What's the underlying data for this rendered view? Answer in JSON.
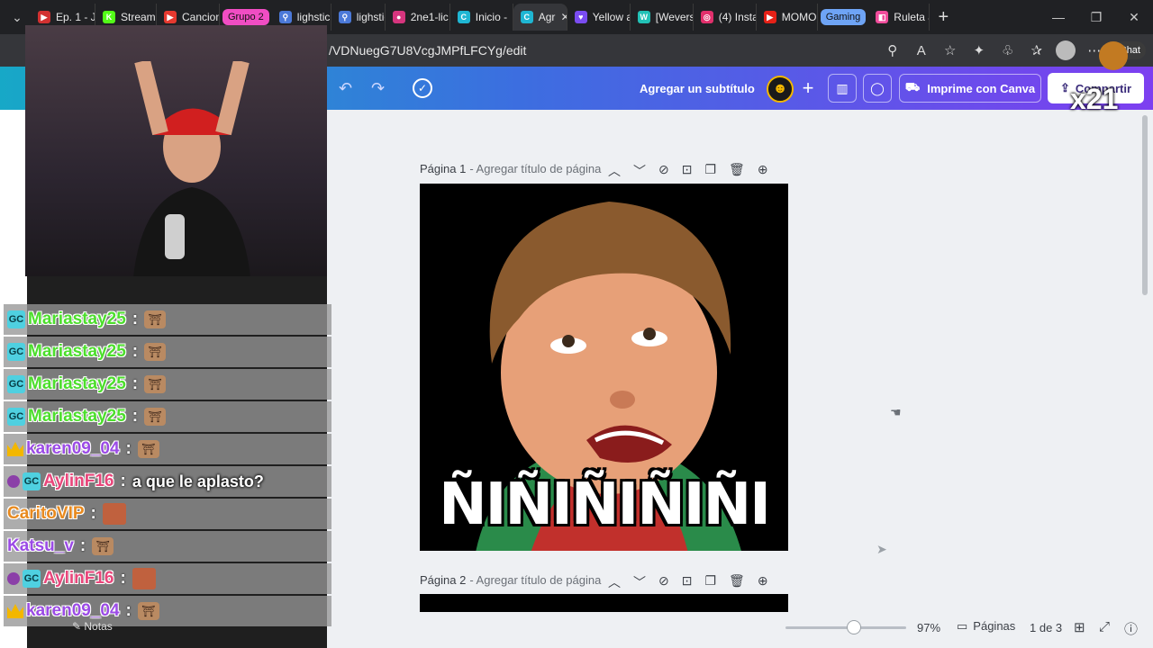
{
  "browser": {
    "tabs": [
      {
        "label": "Ep. 1 - J",
        "fav_color": "#d23131",
        "fav_glyph": "▶"
      },
      {
        "label": "Stream",
        "fav_color": "#53fc18",
        "fav_glyph": "K"
      },
      {
        "label": "Cancion",
        "fav_color": "#e6392f",
        "fav_glyph": "▶"
      },
      {
        "label": "lighstick",
        "fav_color": "#4b79d8",
        "fav_glyph": "⚲"
      },
      {
        "label": "lighstick",
        "fav_color": "#4b79d8",
        "fav_glyph": "⚲"
      },
      {
        "label": "2ne1-lic",
        "fav_color": "#d6357e",
        "fav_glyph": "●"
      },
      {
        "label": "Inicio -",
        "fav_color": "#1fb6d3",
        "fav_glyph": "C"
      },
      {
        "label": "Agr",
        "fav_color": "#1fb6d3",
        "fav_glyph": "C",
        "active": true
      },
      {
        "label": "Yellow a",
        "fav_color": "#7a4cf0",
        "fav_glyph": "♥"
      },
      {
        "label": "[Wevers",
        "fav_color": "#22c1b6",
        "fav_glyph": "W"
      },
      {
        "label": "(4) Insta",
        "fav_color": "#e1306c",
        "fav_glyph": "◎"
      },
      {
        "label": "MOMO",
        "fav_color": "#e62117",
        "fav_glyph": "▶"
      },
      {
        "label": "Ruleta a",
        "fav_color": "#f04c9b",
        "fav_glyph": "◧"
      }
    ],
    "groups": {
      "grupo2": "Grupo 2",
      "gaming": "Gaming"
    },
    "url": "/VDNuegG7U8VcgJMPfLFCYg/edit",
    "chat_label": "Chat"
  },
  "canva": {
    "subtitle": "Agregar un subtítulo",
    "print_label": "Imprime con Canva",
    "share_label": "Compartir",
    "page1_label": "Página 1",
    "page1_title": "- Agregar título de página",
    "page2_label": "Página 2",
    "page2_title": "- Agregar título de página",
    "meme_text": "ÑIÑIÑIÑIÑI",
    "zoom": "97%",
    "pages_label": "Páginas",
    "page_count": "1 de 3",
    "notes_label": "Notas"
  },
  "overlay": {
    "multiplier": "x21"
  },
  "chat": [
    {
      "name": "Mariastay25",
      "color": "#4cde2c",
      "badges": [
        "gc"
      ],
      "message": "",
      "emote": "shrine"
    },
    {
      "name": "Mariastay25",
      "color": "#4cde2c",
      "badges": [
        "gc"
      ],
      "message": "",
      "emote": "shrine"
    },
    {
      "name": "Mariastay25",
      "color": "#4cde2c",
      "badges": [
        "gc"
      ],
      "message": "",
      "emote": "shrine"
    },
    {
      "name": "Mariastay25",
      "color": "#4cde2c",
      "badges": [
        "gc"
      ],
      "message": "",
      "emote": "shrine"
    },
    {
      "name": "karen09_04",
      "color": "#9b4be6",
      "badges": [
        "crown"
      ],
      "message": "",
      "emote": "shrine"
    },
    {
      "name": "AylinF16",
      "color": "#e8457a",
      "badges": [
        "heart",
        "gc"
      ],
      "message": "a que le aplasto?",
      "emote": ""
    },
    {
      "name": "CaritoVIP",
      "color": "#e88a1f",
      "badges": [],
      "message": "",
      "emote": "face"
    },
    {
      "name": "Katsu_v",
      "color": "#9b4be6",
      "badges": [],
      "message": "",
      "emote": "shrine"
    },
    {
      "name": "AylinF16",
      "color": "#e8457a",
      "badges": [
        "heart",
        "gc"
      ],
      "message": "",
      "emote": "face"
    },
    {
      "name": "karen09_04",
      "color": "#9b4be6",
      "badges": [
        "crown"
      ],
      "message": "",
      "emote": "shrine"
    }
  ]
}
